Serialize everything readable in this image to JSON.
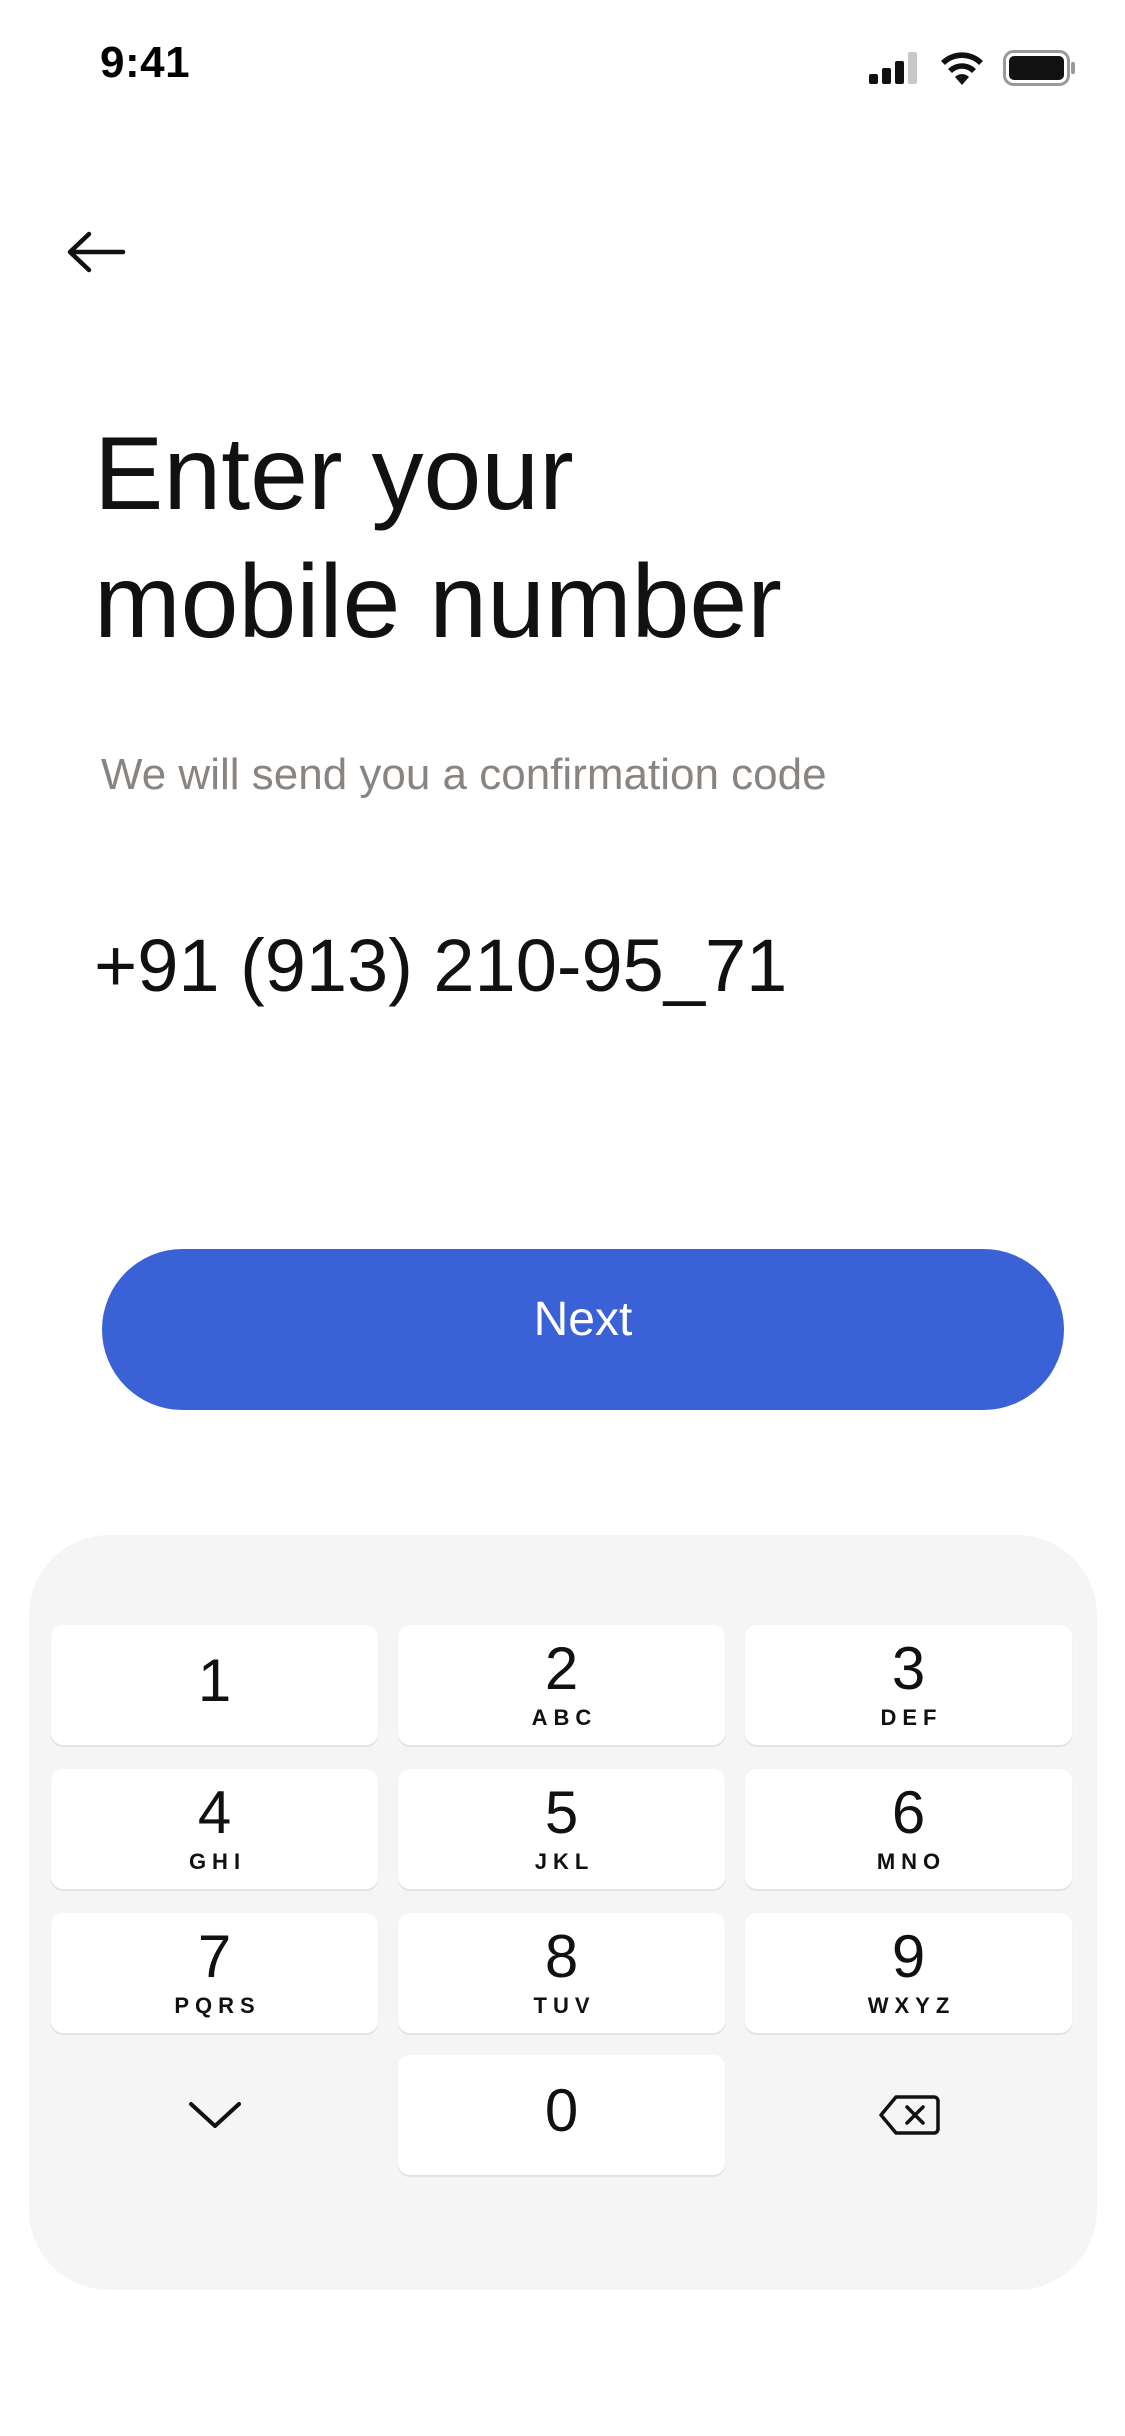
{
  "status_bar": {
    "time": "9:41",
    "icons": [
      "cellular-signal-icon",
      "wifi-icon",
      "battery-icon"
    ]
  },
  "header": {
    "back_icon": "arrow-left-icon"
  },
  "title": {
    "line1": "Enter your",
    "line2": "mobile number"
  },
  "subtitle": "We will send you a confirmation code",
  "phone_field": {
    "value": "+91 (913) 210-95_71"
  },
  "next_button": {
    "label": "Next",
    "color": "#3A62D6"
  },
  "keypad": {
    "keys": [
      {
        "digit": "1",
        "letters": ""
      },
      {
        "digit": "2",
        "letters": "ABC"
      },
      {
        "digit": "3",
        "letters": "DEF"
      },
      {
        "digit": "4",
        "letters": "GHI"
      },
      {
        "digit": "5",
        "letters": "JKL"
      },
      {
        "digit": "6",
        "letters": "MNO"
      },
      {
        "digit": "7",
        "letters": "PQRS"
      },
      {
        "digit": "8",
        "letters": "TUV"
      },
      {
        "digit": "9",
        "letters": "WXYZ"
      },
      {
        "digit": "0",
        "letters": ""
      }
    ],
    "dismiss_icon": "chevron-down-icon",
    "delete_icon": "backspace-icon"
  }
}
